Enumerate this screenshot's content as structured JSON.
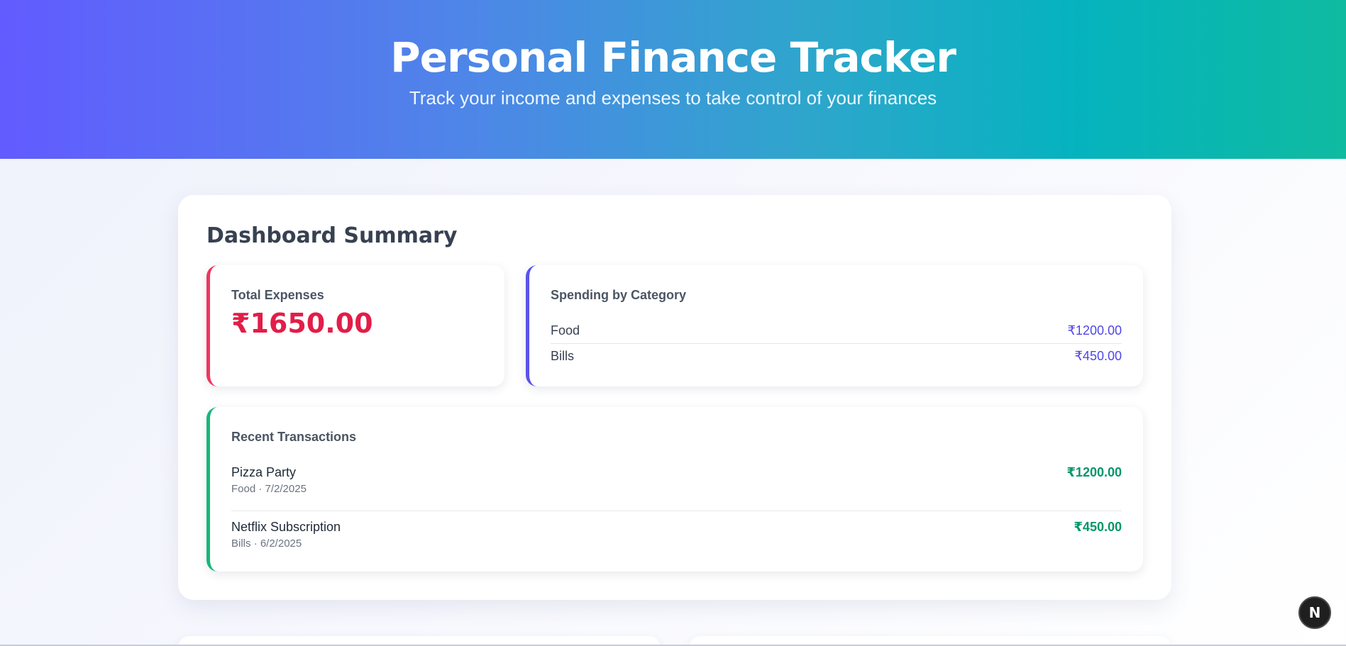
{
  "header": {
    "title": "Personal Finance Tracker",
    "subtitle": "Track your income and expenses to take control of your finances"
  },
  "dashboard": {
    "title": "Dashboard Summary",
    "total_expenses": {
      "label": "Total Expenses",
      "value": "₹1650.00"
    },
    "spending_by_category": {
      "label": "Spending by Category",
      "items": [
        {
          "name": "Food",
          "amount": "₹1200.00"
        },
        {
          "name": "Bills",
          "amount": "₹450.00"
        }
      ]
    },
    "recent_transactions": {
      "label": "Recent Transactions",
      "items": [
        {
          "name": "Pizza Party",
          "meta": "Food · 7/2/2025",
          "amount": "₹1200.00"
        },
        {
          "name": "Netflix Subscription",
          "meta": "Bills · 6/2/2025",
          "amount": "₹450.00"
        }
      ]
    }
  },
  "dev_badge": {
    "letter": "N"
  },
  "colors": {
    "expenses_accent": "#f0355f",
    "category_accent": "#5b53e8",
    "transactions_accent": "#17b67a",
    "amount_green": "#059669",
    "amount_purple": "#4f46e5"
  }
}
